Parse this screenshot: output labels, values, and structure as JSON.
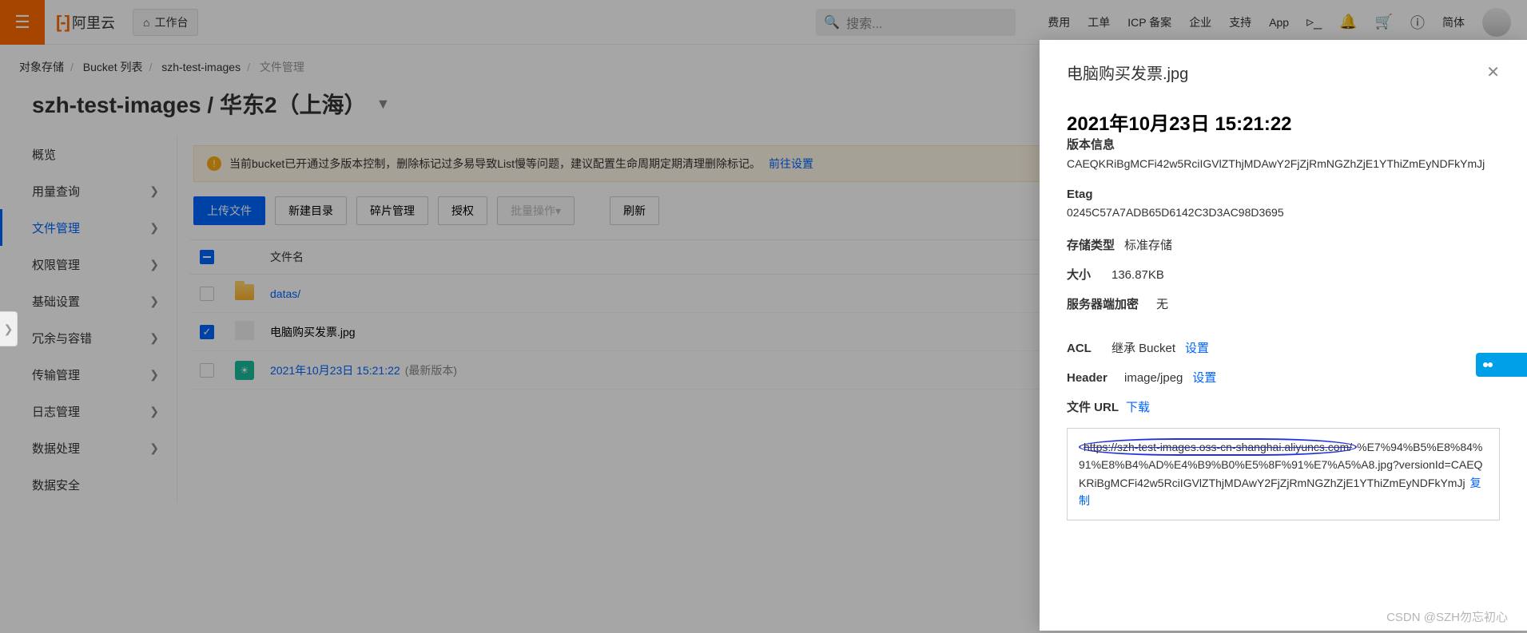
{
  "header": {
    "logo_text": "阿里云",
    "workspace": "工作台",
    "search_placeholder": "搜索...",
    "links": [
      "费用",
      "工单",
      "ICP 备案",
      "企业",
      "支持",
      "App"
    ],
    "lang": "简体"
  },
  "breadcrumb": {
    "items": [
      "对象存储",
      "Bucket 列表",
      "szh-test-images",
      "文件管理"
    ]
  },
  "title": "szh-test-images / 华东2（上海）",
  "sidebar": {
    "items": [
      {
        "label": "概览",
        "chev": false
      },
      {
        "label": "用量查询",
        "chev": true
      },
      {
        "label": "文件管理",
        "chev": true,
        "active": true
      },
      {
        "label": "权限管理",
        "chev": true
      },
      {
        "label": "基础设置",
        "chev": true
      },
      {
        "label": "冗余与容错",
        "chev": true
      },
      {
        "label": "传输管理",
        "chev": true
      },
      {
        "label": "日志管理",
        "chev": true
      },
      {
        "label": "数据处理",
        "chev": true
      },
      {
        "label": "数据安全",
        "chev": false
      }
    ]
  },
  "notice": {
    "text": "当前bucket已开通过多版本控制，删除标记过多易导致List慢等问题，建议配置生命周期定期清理删除标记。",
    "link": "前往设置"
  },
  "toolbar": {
    "upload": "上传文件",
    "mkdir": "新建目录",
    "frag": "碎片管理",
    "auth": "授权",
    "batch": "批量操作",
    "refresh": "刷新"
  },
  "table": {
    "header": "文件名",
    "rows": [
      {
        "icon": "folder",
        "name": "datas/",
        "checked": false
      },
      {
        "icon": "file",
        "name": "电脑购买发票.jpg",
        "checked": true
      },
      {
        "icon": "image",
        "name": "2021年10月23日 15:21:22",
        "version": "(最新版本)",
        "checked": false
      }
    ]
  },
  "drawer": {
    "title": "电脑购买发票.jpg",
    "timestamp": "2021年10月23日 15:21:22",
    "version_label": "版本信息",
    "version_value": "CAEQKRiBgMCFi42w5RciIGVlZThjMDAwY2FjZjRmNGZhZjE1YThiZmEyNDFkYmJj",
    "etag_label": "Etag",
    "etag_value": "0245C57A7ADB65D6142C3D3AC98D3695",
    "storage_label": "存储类型",
    "storage_value": "标准存储",
    "size_label": "大小",
    "size_value": "136.87KB",
    "encrypt_label": "服务器端加密",
    "encrypt_value": "无",
    "acl_label": "ACL",
    "acl_value": "继承 Bucket",
    "acl_link": "设置",
    "header_label": "Header",
    "header_value": "image/jpeg",
    "header_link": "设置",
    "url_label": "文件 URL",
    "url_link": "下载",
    "url_part1": "https://szh-test-images.oss-cn-shanghai.aliyuncs.com/",
    "url_part2": "%E7%94%B5%E8%84%91%E8%B4%AD%E4%B9%B0%E5%8F%91%E7%A5%A8.jpg?versionId=CAEQKRiBgMCFi42w5RciIGVlZThjMDAwY2FjZjRmNGZhZjE1YThiZmEyNDFkYmJj",
    "url_copy": "复制"
  },
  "watermark": "CSDN @SZH勿忘初心"
}
